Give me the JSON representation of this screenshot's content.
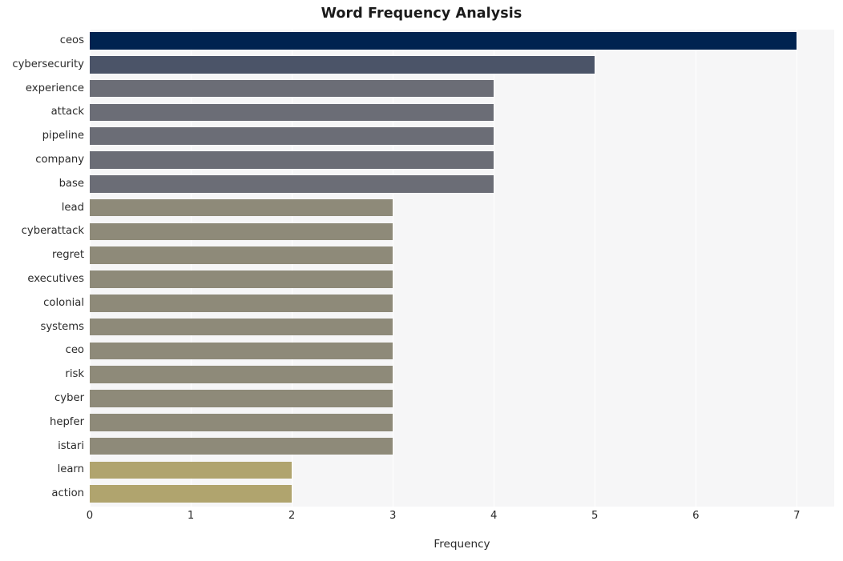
{
  "chart_data": {
    "type": "bar",
    "orientation": "horizontal",
    "title": "Word Frequency Analysis",
    "xlabel": "Frequency",
    "ylabel": "",
    "xlim": [
      0,
      7.37
    ],
    "xticks": [
      0,
      1,
      2,
      3,
      4,
      5,
      6,
      7
    ],
    "xtick_labels": [
      "0",
      "1",
      "2",
      "3",
      "4",
      "5",
      "6",
      "7"
    ],
    "grid": true,
    "grid_axis": "x",
    "legend": false,
    "colormap": "cividis",
    "plot_background": "#f6f6f7",
    "figure_background": "#ffffff",
    "categories": [
      "ceos",
      "cybersecurity",
      "experience",
      "attack",
      "pipeline",
      "company",
      "base",
      "lead",
      "cyberattack",
      "regret",
      "executives",
      "colonial",
      "systems",
      "ceo",
      "risk",
      "cyber",
      "hepfer",
      "istari",
      "learn",
      "action"
    ],
    "values": [
      7,
      5,
      4,
      4,
      4,
      4,
      4,
      3,
      3,
      3,
      3,
      3,
      3,
      3,
      3,
      3,
      3,
      3,
      2,
      2
    ],
    "bar_colors": [
      "#002350",
      "#4b5468",
      "#6b6d76",
      "#6b6d76",
      "#6b6d76",
      "#6b6d76",
      "#6b6d76",
      "#8e8a79",
      "#8e8a79",
      "#8e8a79",
      "#8e8a79",
      "#8e8a79",
      "#8e8a79",
      "#8e8a79",
      "#8e8a79",
      "#8e8a79",
      "#8e8a79",
      "#8e8a79",
      "#b0a46e",
      "#b0a46e"
    ]
  }
}
